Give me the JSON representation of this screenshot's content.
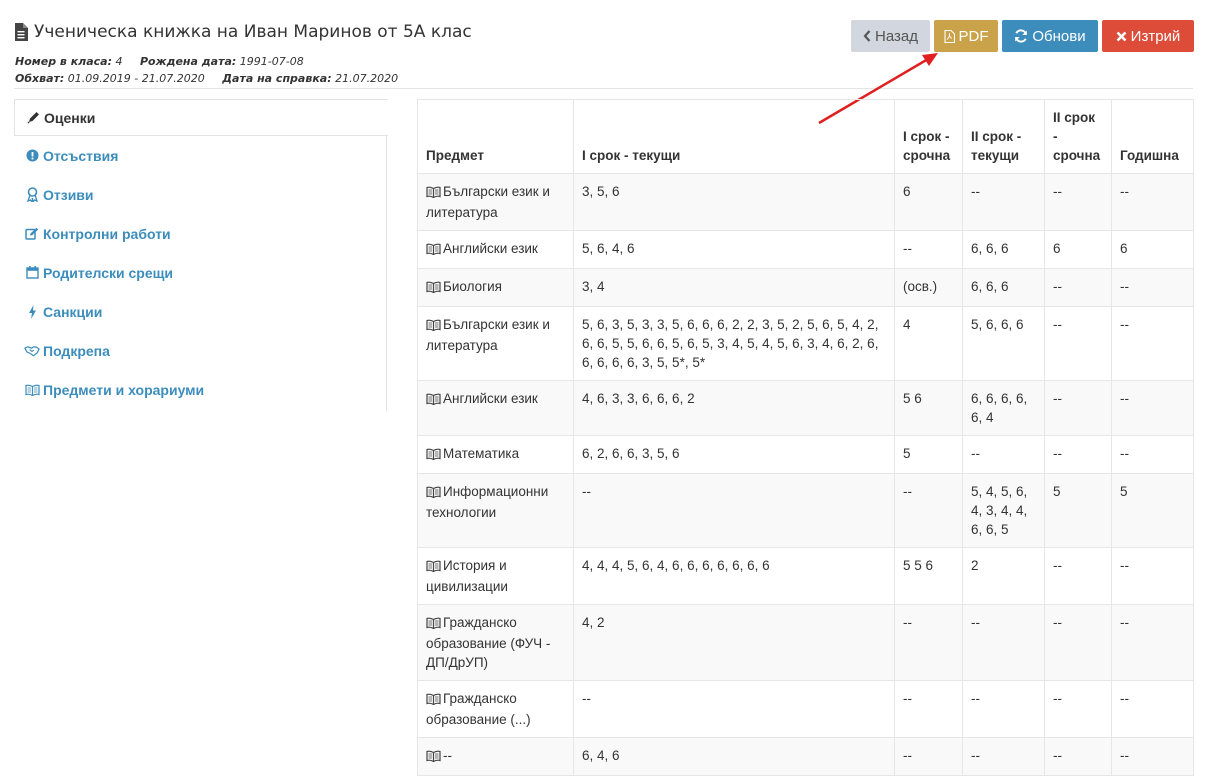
{
  "header": {
    "title": "Ученическа книжка на Иван Маринов от 5А клас",
    "class_number_label": "Номер в класа:",
    "class_number": "4",
    "birth_label": "Рождена дата:",
    "birth_date": "1991-07-08",
    "range_label": "Обхват:",
    "range": "01.09.2019 - 21.07.2020",
    "report_date_label": "Дата на справка:",
    "report_date": "21.07.2020"
  },
  "toolbar": {
    "back_label": "Назад",
    "pdf_label": "PDF",
    "refresh_label": "Обнови",
    "delete_label": "Изтрий"
  },
  "colors": {
    "primary": "#3c8dbc",
    "pdf": "#c9a24a",
    "danger": "#dd4b39",
    "default": "#d2d6de",
    "arrow": "#e02020"
  },
  "sidebar": {
    "items": [
      {
        "label": "Оценки",
        "icon": "pencil-icon",
        "active": true
      },
      {
        "label": "Отсъствия",
        "icon": "exclamation-circle-icon",
        "active": false
      },
      {
        "label": "Отзиви",
        "icon": "award-icon",
        "active": false
      },
      {
        "label": "Контролни работи",
        "icon": "edit-icon",
        "active": false
      },
      {
        "label": "Родителски срещи",
        "icon": "calendar-icon",
        "active": false
      },
      {
        "label": "Санкции",
        "icon": "bolt-icon",
        "active": false
      },
      {
        "label": "Подкрепа",
        "icon": "handshake-icon",
        "active": false
      },
      {
        "label": "Предмети и хорариуми",
        "icon": "book-icon",
        "active": false
      }
    ]
  },
  "table": {
    "columns": [
      "Предмет",
      "I срок - текущи",
      "I срок - срочна",
      "II срок - текущи",
      "II срок - срочна",
      "Годишна"
    ],
    "rows": [
      [
        "Български език и литература",
        "3, 5, 6",
        "6",
        "--",
        "--",
        "--"
      ],
      [
        "Английски език",
        "5, 6, 4, 6",
        "--",
        "6, 6, 6",
        "6",
        "6"
      ],
      [
        "Биология",
        "3, 4",
        "(осв.)",
        "6, 6, 6",
        "--",
        "--"
      ],
      [
        "Български език и литература",
        "5, 6, 3, 5, 3, 3, 5, 6, 6, 6, 2, 2, 3, 5, 2, 5, 6, 5, 4, 2, 6, 6, 5, 5, 6, 6, 5, 6, 5, 3, 4, 5, 4, 5, 6, 3, 4, 6, 2, 6, 6, 6, 6, 6, 3, 5, 5*, 5*",
        "4",
        "5, 6, 6, 6",
        "--",
        "--"
      ],
      [
        "Английски език",
        "4, 6, 3, 3, 6, 6, 6, 2",
        "5 6",
        "6, 6, 6, 6, 6, 4",
        "--",
        "--"
      ],
      [
        "Математика",
        "6, 2, 6, 6, 3, 5, 6",
        "5",
        "--",
        "--",
        "--"
      ],
      [
        "Информационни технологии",
        "--",
        "--",
        "5, 4, 5, 6, 4, 3, 4, 4, 6, 6, 5",
        "5",
        "5"
      ],
      [
        "История и цивилизации",
        "4, 4, 4, 5, 6, 4, 6, 6, 6, 6, 6, 6, 6",
        "5 5 6",
        "2",
        "--",
        "--"
      ],
      [
        "Гражданско образование (ФУЧ - ДП/ДрУП)",
        "4, 2",
        "--",
        "--",
        "--",
        "--"
      ],
      [
        "Гражданско образование (...)",
        "--",
        "--",
        "--",
        "--",
        "--"
      ],
      [
        "--",
        "6, 4, 6",
        "--",
        "--",
        "--",
        "--"
      ]
    ]
  }
}
